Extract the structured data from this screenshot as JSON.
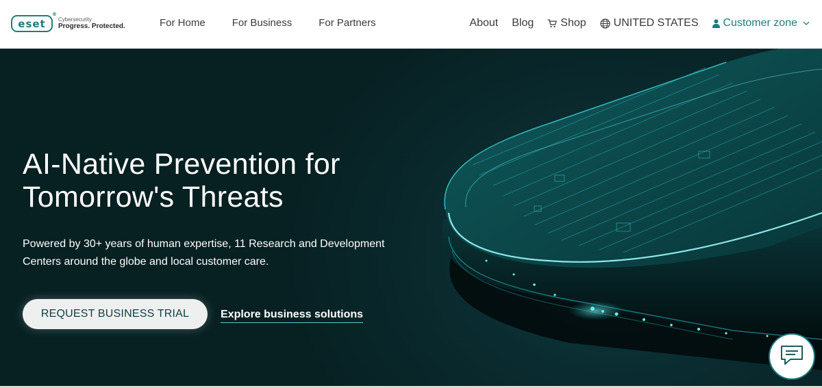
{
  "logo": {
    "mark": "eset",
    "registered": "®",
    "tagline_small": "Cybersecurity",
    "tagline": "Progress. Protected."
  },
  "nav_main": [
    {
      "label": "For Home"
    },
    {
      "label": "For Business"
    },
    {
      "label": "For Partners"
    }
  ],
  "nav_right": {
    "about": "About",
    "blog": "Blog",
    "shop": "Shop",
    "region": "UNITED STATES",
    "customer_zone": "Customer zone"
  },
  "hero": {
    "title_line1": "AI-Native Prevention for",
    "title_line2": "Tomorrow's Threats",
    "subtitle": "Powered by 30+ years of human expertise, 11 Research and Development Centers around the globe and local customer care.",
    "primary_cta": "REQUEST BUSINESS TRIAL",
    "secondary_cta": "Explore business solutions"
  },
  "icons": {
    "cart": "cart-icon",
    "globe": "globe-icon",
    "user": "user-icon",
    "chevron": "chevron-down-icon",
    "chat": "chat-icon"
  },
  "colors": {
    "brand_teal": "#1e7c7e",
    "hero_bg": "#0a2c30",
    "glow": "#4fe3e6"
  }
}
